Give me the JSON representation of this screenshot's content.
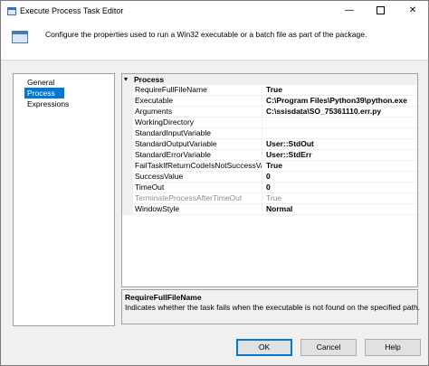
{
  "window": {
    "title": "Execute Process Task Editor",
    "icon": "task-editor-icon"
  },
  "titlebar_buttons": {
    "minimize": "—",
    "close": "✕"
  },
  "header": {
    "description": "Configure the properties used to run a Win32 executable or a batch file as part of the package.",
    "icon": "process-icon"
  },
  "sidebar": {
    "items": [
      {
        "label": "General",
        "selected": false
      },
      {
        "label": "Process",
        "selected": true
      },
      {
        "label": "Expressions",
        "selected": false
      }
    ]
  },
  "property_grid": {
    "category": {
      "label": "Process",
      "expanded": true,
      "toggle": "▾"
    },
    "properties": [
      {
        "name": "RequireFullFileName",
        "value": "True"
      },
      {
        "name": "Executable",
        "value": "C:\\Program Files\\Python39\\python.exe"
      },
      {
        "name": "Arguments",
        "value": "C:\\ssisdata\\SO_75361110.err.py"
      },
      {
        "name": "WorkingDirectory",
        "value": ""
      },
      {
        "name": "StandardInputVariable",
        "value": ""
      },
      {
        "name": "StandardOutputVariable",
        "value": "User::StdOut"
      },
      {
        "name": "StandardErrorVariable",
        "value": "User::StdErr"
      },
      {
        "name": "FailTaskIfReturnCodeIsNotSuccessValue",
        "value": "True"
      },
      {
        "name": "SuccessValue",
        "value": "0"
      },
      {
        "name": "TimeOut",
        "value": "0"
      },
      {
        "name": "TerminateProcessAfterTimeOut",
        "value": "True",
        "disabled": true
      },
      {
        "name": "WindowStyle",
        "value": "Normal"
      }
    ]
  },
  "description_panel": {
    "title": "RequireFullFileName",
    "text": "Indicates whether the task fails when the executable is not found on the specified path."
  },
  "buttons": {
    "ok": "OK",
    "cancel": "Cancel",
    "help": "Help"
  },
  "colors": {
    "selection": "#0078d7",
    "panel_background": "#f0f0f0",
    "disabled_text": "#8f8f8f"
  }
}
